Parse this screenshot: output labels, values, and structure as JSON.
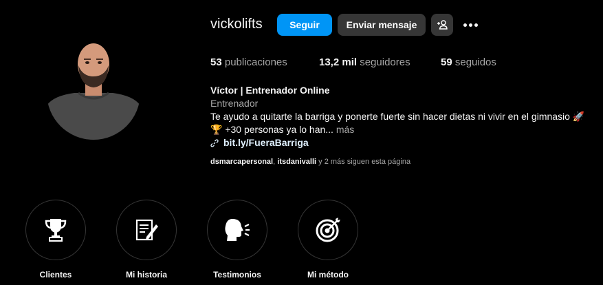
{
  "profile": {
    "username": "vickolifts",
    "follow_label": "Seguir",
    "message_label": "Enviar mensaje",
    "icons": {
      "suggest": "person-add-icon",
      "more": "more-options-icon",
      "link": "link-icon"
    }
  },
  "stats": {
    "posts_count": "53",
    "posts_label": "publicaciones",
    "followers_count": "13,2 mil",
    "followers_label": "seguidores",
    "following_count": "59",
    "following_label": "seguidos"
  },
  "bio": {
    "name": "Víctor | Entrenador Online",
    "category": "Entrenador",
    "line1": "Te ayudo a quitarte la barriga y ponerte fuerte sin hacer dietas ni vivir en el gimnasio 🚀",
    "line2": "🏆 +30 personas ya lo han...",
    "more": "más",
    "link": "bit.ly/FueraBarriga"
  },
  "followed_by": {
    "user1": "dsmarcapersonal",
    "separator": ", ",
    "user2": "itsdanivalli",
    "rest": " y 2 más siguen esta página"
  },
  "highlights": [
    {
      "label": "Clientes",
      "icon": "trophy-icon"
    },
    {
      "label": "Mi historia",
      "icon": "document-pen-icon"
    },
    {
      "label": "Testimonios",
      "icon": "speaking-head-icon"
    },
    {
      "label": "Mi método",
      "icon": "target-arrow-icon"
    }
  ],
  "colors": {
    "accent": "#0095f6",
    "button_dark": "#363636",
    "background": "#000000",
    "secondary_text": "#a8a8a8"
  }
}
